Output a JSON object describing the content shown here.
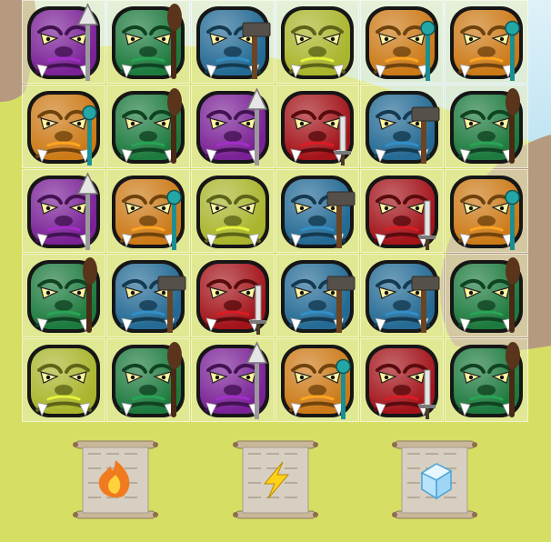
{
  "palette": {
    "purple": "#7a2196",
    "green": "#1d7a3e",
    "blue": "#246a94",
    "olive": "#a9b52c",
    "orange": "#cc7a17",
    "red": "#a3141a"
  },
  "board": {
    "rows": [
      [
        {
          "color": "purple",
          "weapon": "spear"
        },
        {
          "color": "green",
          "weapon": "club"
        },
        {
          "color": "blue",
          "weapon": "hammer"
        },
        {
          "color": "olive",
          "weapon": "none"
        },
        {
          "color": "orange",
          "weapon": "staff"
        },
        {
          "color": "orange",
          "weapon": "staff"
        }
      ],
      [
        {
          "color": "orange",
          "weapon": "staff"
        },
        {
          "color": "green",
          "weapon": "club"
        },
        {
          "color": "purple",
          "weapon": "spear"
        },
        {
          "color": "red",
          "weapon": "sword"
        },
        {
          "color": "blue",
          "weapon": "hammer"
        },
        {
          "color": "green",
          "weapon": "club"
        }
      ],
      [
        {
          "color": "purple",
          "weapon": "spear"
        },
        {
          "color": "orange",
          "weapon": "staff"
        },
        {
          "color": "olive",
          "weapon": "none"
        },
        {
          "color": "blue",
          "weapon": "hammer"
        },
        {
          "color": "red",
          "weapon": "sword"
        },
        {
          "color": "orange",
          "weapon": "staff"
        }
      ],
      [
        {
          "color": "green",
          "weapon": "club"
        },
        {
          "color": "blue",
          "weapon": "hammer"
        },
        {
          "color": "red",
          "weapon": "sword"
        },
        {
          "color": "blue",
          "weapon": "hammer"
        },
        {
          "color": "blue",
          "weapon": "hammer"
        },
        {
          "color": "green",
          "weapon": "club"
        }
      ],
      [
        {
          "color": "olive",
          "weapon": "none"
        },
        {
          "color": "green",
          "weapon": "club"
        },
        {
          "color": "purple",
          "weapon": "spear"
        },
        {
          "color": "orange",
          "weapon": "staff"
        },
        {
          "color": "red",
          "weapon": "sword"
        },
        {
          "color": "green",
          "weapon": "club"
        }
      ]
    ]
  },
  "powerups": [
    {
      "icon": "fire-icon"
    },
    {
      "icon": "lightning-icon"
    },
    {
      "icon": "ice-cube-icon"
    }
  ]
}
